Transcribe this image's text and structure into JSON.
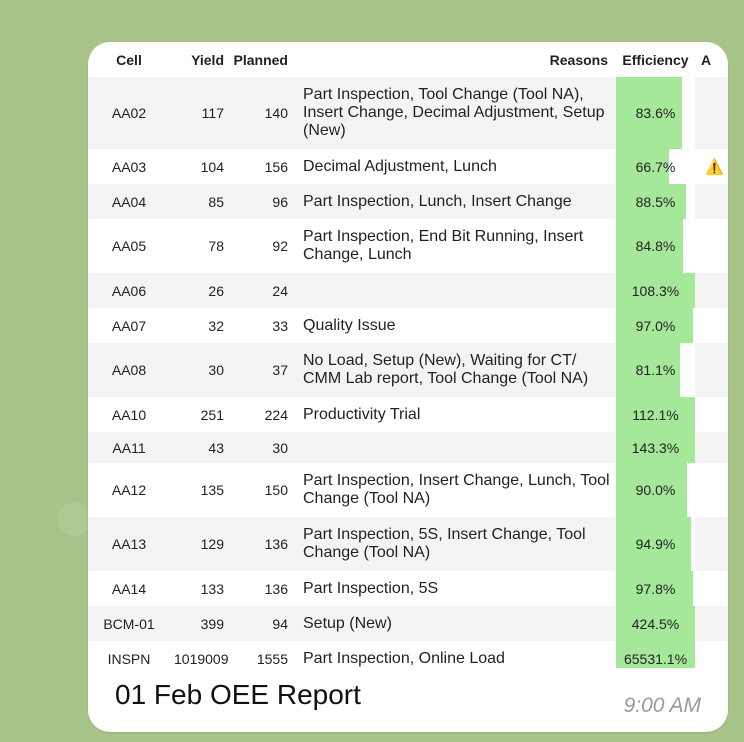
{
  "table": {
    "headers": [
      "Cell",
      "Yield",
      "Planned",
      "Reasons",
      "Efficiency",
      "A"
    ],
    "rows": [
      {
        "cell": "AA02",
        "yield": "117",
        "planned": "140",
        "reasons": "Part Inspection, Tool Change (Tool NA), Insert Change, Decimal Adjustment, Setup (New)",
        "efficiency": "83.6%",
        "fill": 0.836,
        "alert": ""
      },
      {
        "cell": "AA03",
        "yield": "104",
        "planned": "156",
        "reasons": "Decimal Adjustment, Lunch",
        "efficiency": "66.7%",
        "fill": 0.667,
        "alert": "⚠️"
      },
      {
        "cell": "AA04",
        "yield": "85",
        "planned": "96",
        "reasons": "Part Inspection, Lunch, Insert Change",
        "efficiency": "88.5%",
        "fill": 0.885,
        "alert": ""
      },
      {
        "cell": "AA05",
        "yield": "78",
        "planned": "92",
        "reasons": "Part Inspection, End Bit Running, Insert Change, Lunch",
        "efficiency": "84.8%",
        "fill": 0.848,
        "alert": ""
      },
      {
        "cell": "AA06",
        "yield": "26",
        "planned": "24",
        "reasons": "",
        "efficiency": "108.3%",
        "fill": 1.0,
        "alert": ""
      },
      {
        "cell": "AA07",
        "yield": "32",
        "planned": "33",
        "reasons": "Quality Issue",
        "efficiency": "97.0%",
        "fill": 0.97,
        "alert": ""
      },
      {
        "cell": "AA08",
        "yield": "30",
        "planned": "37",
        "reasons": "No Load, Setup (New), Waiting for CT/ CMM Lab report, Tool Change (Tool NA)",
        "efficiency": "81.1%",
        "fill": 0.811,
        "alert": ""
      },
      {
        "cell": "AA10",
        "yield": "251",
        "planned": "224",
        "reasons": "Productivity Trial",
        "efficiency": "112.1%",
        "fill": 1.0,
        "alert": ""
      },
      {
        "cell": "AA11",
        "yield": "43",
        "planned": "30",
        "reasons": "",
        "efficiency": "143.3%",
        "fill": 1.0,
        "alert": ""
      },
      {
        "cell": "AA12",
        "yield": "135",
        "planned": "150",
        "reasons": "Part Inspection, Insert Change, Lunch, Tool Change (Tool NA)",
        "efficiency": "90.0%",
        "fill": 0.9,
        "alert": ""
      },
      {
        "cell": "AA13",
        "yield": "129",
        "planned": "136",
        "reasons": "Part Inspection, 5S, Insert Change, Tool Change (Tool NA)",
        "efficiency": "94.9%",
        "fill": 0.949,
        "alert": ""
      },
      {
        "cell": "AA14",
        "yield": "133",
        "planned": "136",
        "reasons": "Part Inspection, 5S",
        "efficiency": "97.8%",
        "fill": 0.978,
        "alert": ""
      },
      {
        "cell": "BCM-01",
        "yield": "399",
        "planned": "94",
        "reasons": "Setup (New)",
        "efficiency": "424.5%",
        "fill": 1.0,
        "alert": ""
      },
      {
        "cell": "INSPN",
        "yield": "1019009",
        "planned": "1555",
        "reasons": "Part Inspection, Online Load",
        "efficiency": "65531.1%",
        "fill": 1.0,
        "alert": ""
      }
    ]
  },
  "message": {
    "caption": "01 Feb OEE Report",
    "time": "9:00 AM"
  },
  "colors": {
    "bar": "#a6e89a",
    "chat_background": "#a9c48a",
    "stripe": "#f4f4f4"
  }
}
